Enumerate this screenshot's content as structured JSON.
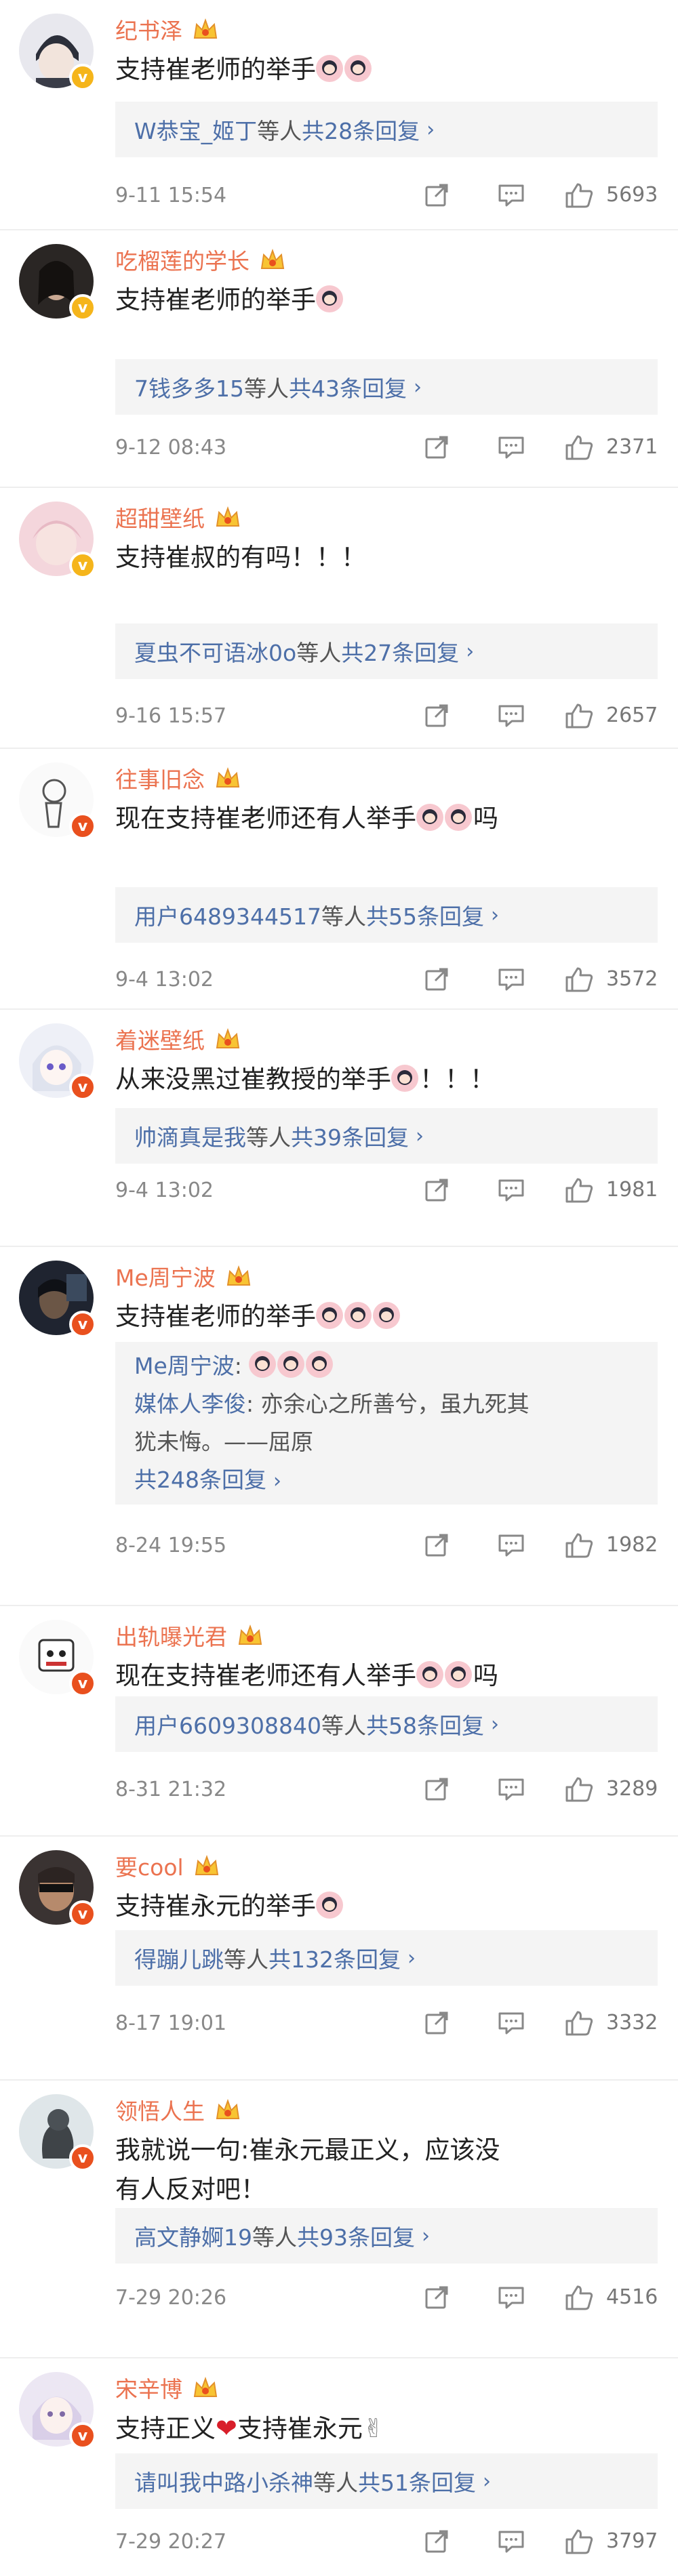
{
  "colors": {
    "username": "#eb7350",
    "link": "#4d6fa8",
    "reply_bg": "#f4f4f4",
    "badge_gold": "#f5b51b",
    "badge_red": "#e9501e",
    "text": "#222222",
    "meta": "#888888"
  },
  "comments": [
    {
      "user": "纪书泽",
      "badge": "gold",
      "text": "支持崔老师的举手",
      "emoji_count": 2,
      "reply_users": "W恭宝_姬丁",
      "reply_mid": "等人 ",
      "reply_count": "共28条回复",
      "time": "9-11 15:54",
      "likes": "5693"
    },
    {
      "user": "吃榴莲的学长",
      "badge": "gold",
      "text": "支持崔老师的举手",
      "emoji_count": 1,
      "reply_users": "7钱多多15",
      "reply_mid": "等人 ",
      "reply_count": "共43条回复",
      "time": "9-12 08:43",
      "likes": "2371"
    },
    {
      "user": "超甜壁纸",
      "badge": "gold",
      "text": "支持崔叔的有吗！！！",
      "emoji_count": 0,
      "reply_users": "夏虫不可语冰0o",
      "reply_mid": "等人 ",
      "reply_count": "共27条回复",
      "time": "9-16 15:57",
      "likes": "2657"
    },
    {
      "user": "往事旧念",
      "badge": "red",
      "text": "现在支持崔老师还有人举手",
      "emoji_count": 2,
      "text_suffix": "吗",
      "reply_users": "用户6489344517",
      "reply_mid": "等人 ",
      "reply_count": "共55条回复",
      "time": "9-4 13:02",
      "likes": "3572"
    },
    {
      "user": "着迷壁纸",
      "badge": "red",
      "text": "从来没黑过崔教授的举手",
      "emoji_count": 1,
      "text_suffix": "！！！",
      "reply_users": "帅滴真是我",
      "reply_mid": "等人 ",
      "reply_count": "共39条回复",
      "time": "9-4 13:02",
      "likes": "1981"
    },
    {
      "user": "Me周宁波",
      "badge": "red",
      "text": "支持崔老师的举手",
      "emoji_count": 3,
      "reply_expanded": {
        "line1_user": "Me周宁波",
        "line1_sep": ": ",
        "line1_emoji_count": 3,
        "line2_user": "媒体人李俊",
        "line2_text": ": 亦余心之所善兮，虽九死其",
        "line3_text": "犹未悔。——屈原",
        "more": "共248条回复"
      },
      "time": "8-24 19:55",
      "likes": "1982"
    },
    {
      "user": "出轨曝光君",
      "badge": "red",
      "text": "现在支持崔老师还有人举手",
      "emoji_count": 2,
      "text_suffix": "吗",
      "reply_users": "用户6609308840",
      "reply_mid": "等人 ",
      "reply_count": "共58条回复",
      "time": "8-31 21:32",
      "likes": "3289"
    },
    {
      "user": "要cool",
      "badge": "red",
      "text": "支持崔永元的举手",
      "emoji_count": 1,
      "reply_users": "得蹦儿跳",
      "reply_mid": "等人 ",
      "reply_count": "共132条回复",
      "time": "8-17 19:01",
      "likes": "3332"
    },
    {
      "user": "领悟人生",
      "badge": "red",
      "text": "我就说一句:崔永元最正义，应该没",
      "text_line2": "有人反对吧！",
      "emoji_count": 0,
      "reply_users": "高文静婀19",
      "reply_mid": "等人 ",
      "reply_count": "共93条回复",
      "time": "7-29 20:26",
      "likes": "4516"
    },
    {
      "user": "宋辛博",
      "badge": "red",
      "text": "支持正义",
      "text_mid": "支持崔永元",
      "emoji_count": 0,
      "reply_users": "请叫我中路小杀神",
      "reply_mid": "等人 ",
      "reply_count": "共51条回复",
      "time": "7-29 20:27",
      "likes": "3797"
    }
  ]
}
